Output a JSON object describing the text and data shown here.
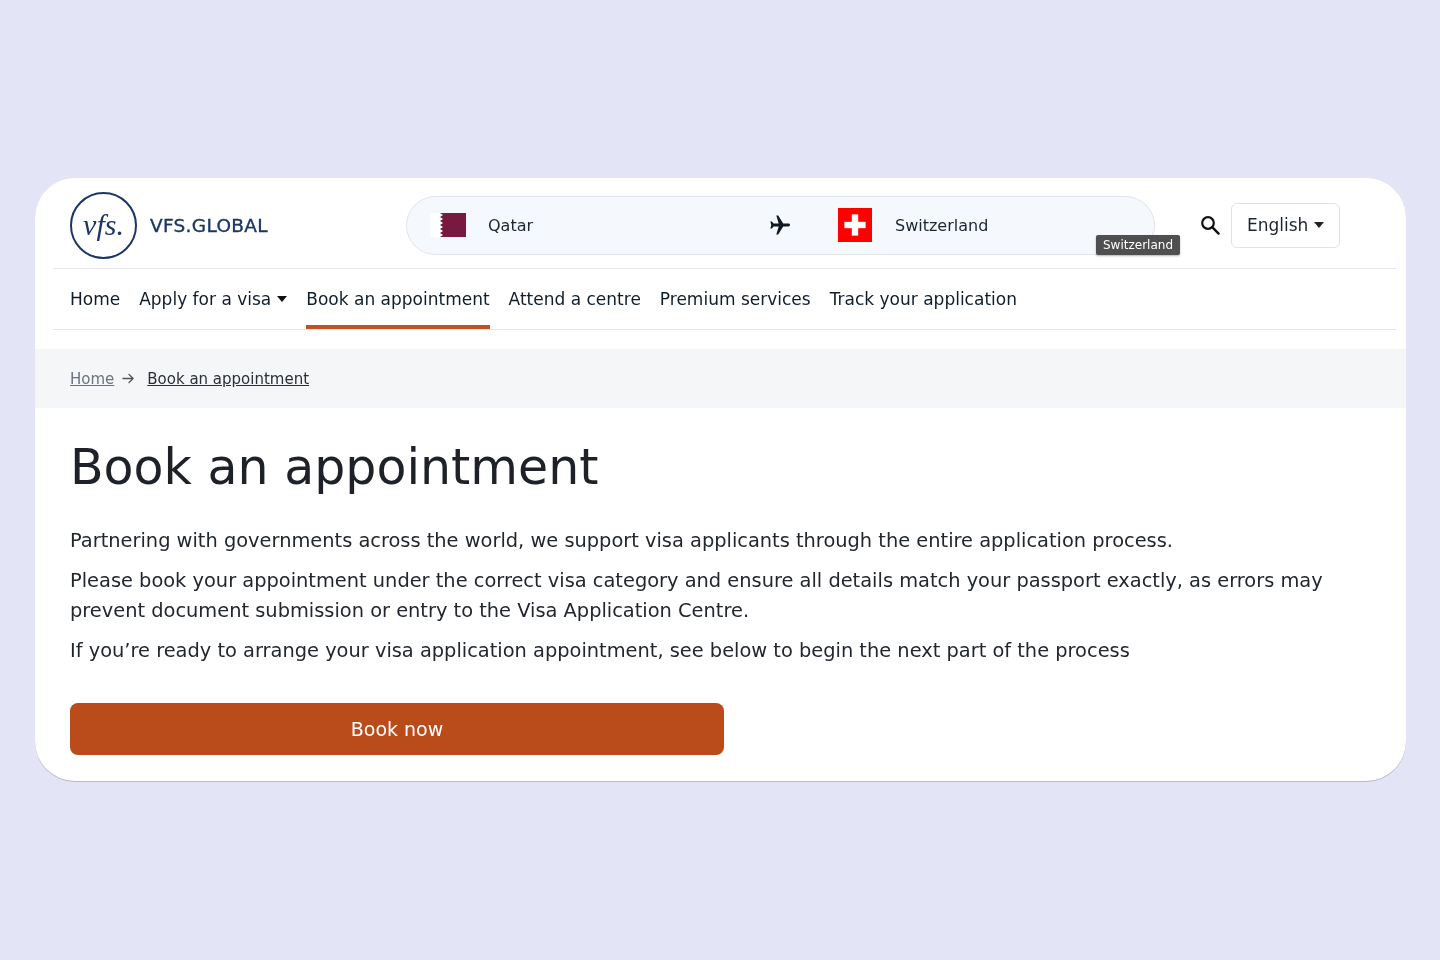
{
  "header": {
    "logo": {
      "emblem": "vfs.",
      "name": "VFS.GLOBAL"
    },
    "route": {
      "origin": "Qatar",
      "destination": "Switzerland",
      "tooltip": "Switzerland"
    },
    "language": "English"
  },
  "nav": [
    {
      "label": "Home",
      "selected": false,
      "dropdown": false
    },
    {
      "label": "Apply for a visa",
      "selected": false,
      "dropdown": true
    },
    {
      "label": "Book an appointment",
      "selected": true,
      "dropdown": false
    },
    {
      "label": "Attend a centre",
      "selected": false,
      "dropdown": false
    },
    {
      "label": "Premium services",
      "selected": false,
      "dropdown": false
    },
    {
      "label": "Track your application",
      "selected": false,
      "dropdown": false
    }
  ],
  "breadcrumb": [
    {
      "label": "Home",
      "current": false
    },
    {
      "label": "Book an appointment",
      "current": true
    }
  ],
  "page": {
    "title": "Book an appointment",
    "paragraphs": [
      "Partnering with governments across the world, we support visa applicants through the entire application process.",
      "Please book your appointment under the correct visa category and ensure all details match your passport exactly, as errors may prevent document submission or entry to the Visa Application Centre.",
      "If you’re ready to arrange your visa application appointment, see below to begin the next part of the process"
    ],
    "button": "Book now"
  }
}
